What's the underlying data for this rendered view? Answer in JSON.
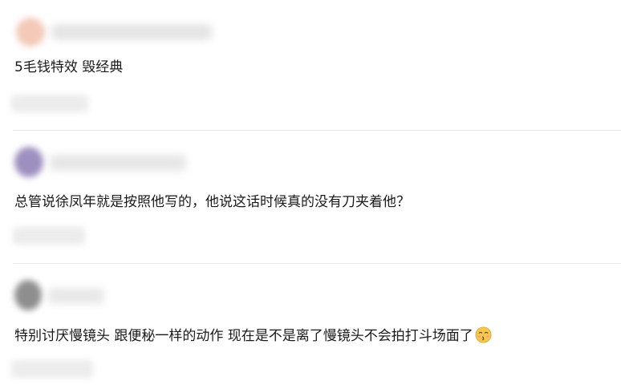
{
  "comments": [
    {
      "text": "5毛钱特效 毁经典",
      "avatar_color": "#f3c5b4",
      "avatar_icon": "blurred-avatar",
      "emoji": ""
    },
    {
      "text": "总管说徐凤年就是按照他写的，他说这话时候真的没有刀夹着他？",
      "avatar_color": "#9a8ab8",
      "avatar_icon": "blurred-avatar",
      "emoji": ""
    },
    {
      "text": "特别讨厌慢镜头 跟便秘一样的动作 现在是不是离了慢镜头不会拍打斗场面了",
      "avatar_color": "#8c8c8c",
      "avatar_icon": "blurred-avatar",
      "emoji": "kissing-face-emoji"
    }
  ],
  "colors": {
    "text": "#1a1a1a",
    "divider": "#e8e8e8",
    "blur_placeholder": "#e6e6e6",
    "emoji_face": "#f7c948"
  }
}
